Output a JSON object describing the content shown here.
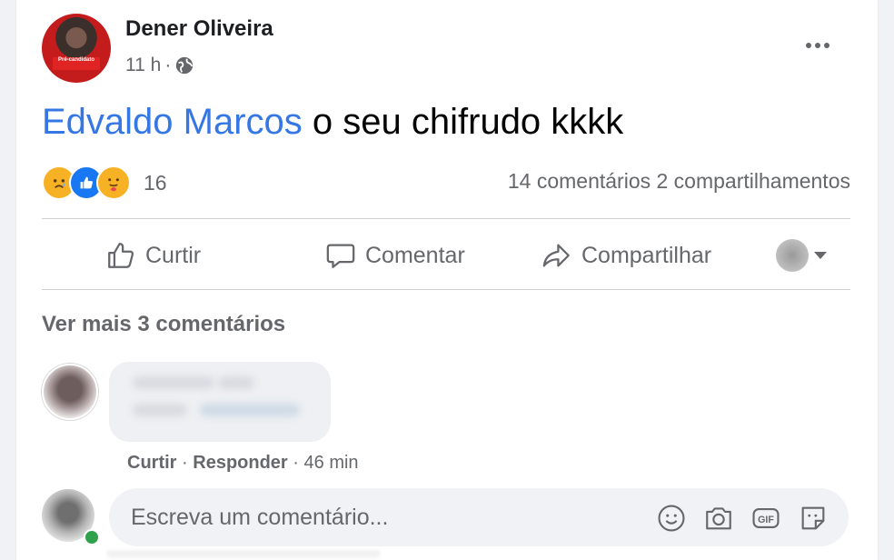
{
  "post": {
    "author": "Dener Oliveira",
    "time": "11 h",
    "separator": "·",
    "avatar_badge": "Pré-candidato",
    "mention": "Edvaldo Marcos",
    "text": " o seu chifrudo kkkk"
  },
  "reactions": {
    "icons": [
      "sad-icon",
      "like-icon",
      "care-icon"
    ],
    "count": "16"
  },
  "stats": {
    "comments": "14 comentários",
    "shares": "2 compartilhamentos"
  },
  "actions": {
    "like": "Curtir",
    "comment": "Comentar",
    "share": "Compartilhar"
  },
  "comments": {
    "see_more": "Ver mais 3 comentários",
    "first": {
      "like": "Curtir",
      "reply": "Responder",
      "time": "46 min"
    }
  },
  "composer": {
    "placeholder": "Escreva um comentário..."
  },
  "colors": {
    "mention": "#3578e5",
    "secondary_text": "#65676b",
    "like_blue": "#1877f2",
    "online_green": "#31a24c"
  }
}
